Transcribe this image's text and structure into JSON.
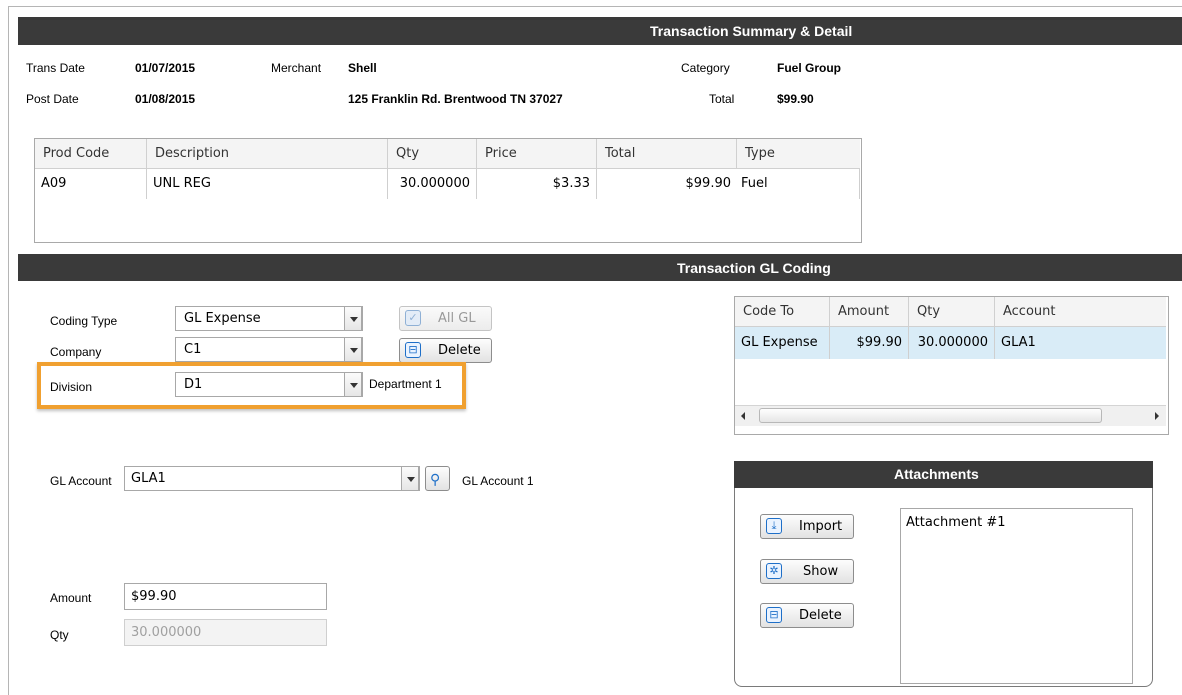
{
  "summary": {
    "header": "Transaction Summary & Detail",
    "trans_date_label": "Trans Date",
    "trans_date": "01/07/2015",
    "post_date_label": "Post Date",
    "post_date": "01/08/2015",
    "merchant_label": "Merchant",
    "merchant": "Shell",
    "address": "125 Franklin Rd. Brentwood TN 37027",
    "category_label": "Category",
    "category": "Fuel Group",
    "total_label": "Total",
    "total": "$99.90"
  },
  "products": {
    "columns": [
      "Prod Code",
      "Description",
      "Qty",
      "Price",
      "Total",
      "Type"
    ],
    "rows": [
      {
        "prod_code": "A09",
        "description": "UNL REG",
        "qty": "30.000000",
        "price": "$3.33",
        "total": "$99.90",
        "type": "Fuel"
      }
    ]
  },
  "coding": {
    "header": "Transaction GL Coding",
    "coding_type_label": "Coding Type",
    "coding_type": "GL Expense",
    "company_label": "Company",
    "company": "C1",
    "division_label": "Division",
    "division": "D1",
    "division_desc": "Department 1",
    "all_gl_label": "All GL",
    "delete_label": "Delete",
    "gl_account_label": "GL Account",
    "gl_account": "GLA1",
    "gl_account_desc": "GL Account 1",
    "amount_label": "Amount",
    "amount": "$99.90",
    "qty_label": "Qty",
    "qty_placeholder": "30.000000",
    "highlight_color": "#f0a030"
  },
  "coding_grid": {
    "columns": [
      "Code To",
      "Amount",
      "Qty",
      "Account"
    ],
    "rows": [
      {
        "code_to": "GL Expense",
        "amount": "$99.90",
        "qty": "30.000000",
        "account": "GLA1"
      }
    ]
  },
  "attachments": {
    "header": "Attachments",
    "import_label": "Import",
    "show_label": "Show",
    "delete_label": "Delete",
    "items": [
      "Attachment #1"
    ]
  }
}
